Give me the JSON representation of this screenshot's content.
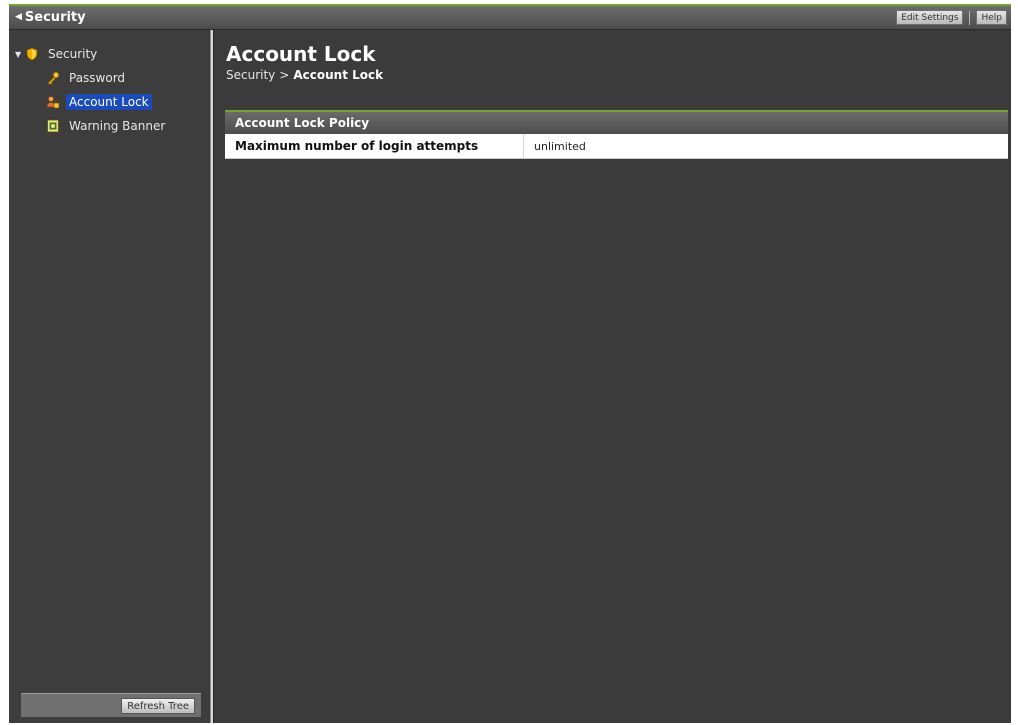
{
  "titlebar": {
    "title": "Security",
    "edit_settings_label": "Edit Settings",
    "help_label": "Help"
  },
  "tree": {
    "root": {
      "label": "Security",
      "icon": "shield-icon"
    },
    "items": [
      {
        "label": "Password",
        "icon": "key-icon"
      },
      {
        "label": "Account Lock",
        "icon": "user-lock-icon",
        "selected": true
      },
      {
        "label": "Warning Banner",
        "icon": "banner-icon"
      }
    ]
  },
  "sidebar": {
    "refresh_label": "Refresh Tree"
  },
  "main": {
    "title": "Account Lock",
    "breadcrumb": {
      "parent": "Security",
      "separator": ">",
      "current": "Account Lock"
    },
    "panel": {
      "header": "Account Lock Policy",
      "rows": [
        {
          "key": "Maximum number of login attempts",
          "value": "unlimited"
        }
      ]
    }
  },
  "colors": {
    "accent_green": "#74a52a",
    "selection_blue": "#1a4bb8",
    "background": "#3b3b3b"
  }
}
